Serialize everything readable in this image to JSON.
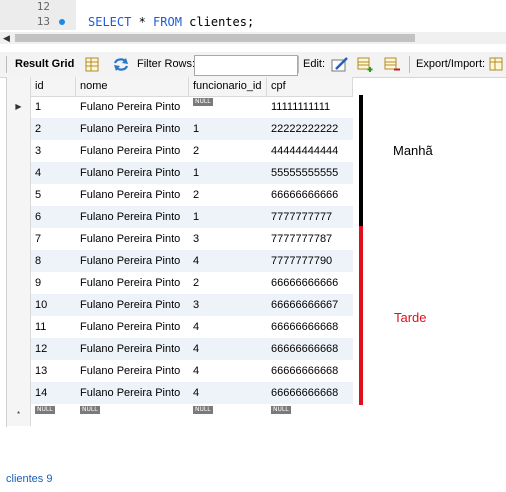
{
  "editor": {
    "lines": [
      {
        "number": "12",
        "code_kw1": "",
        "code_text": "",
        "code_kw2": "",
        "code_tail": ""
      },
      {
        "number": "13",
        "code_kw1": "SELECT",
        "code_text": " * ",
        "code_kw2": "FROM",
        "code_tail": " clientes;"
      }
    ]
  },
  "toolbar": {
    "result_grid": "Result Grid",
    "filter_rows": "Filter Rows:",
    "filter_value": "",
    "edit": "Edit:",
    "export_import": "Export/Import:"
  },
  "grid": {
    "columns": [
      "id",
      "nome",
      "funcionario_id",
      "cpf"
    ],
    "null_label": "NULL",
    "rows": [
      {
        "id": "1",
        "nome": "Fulano Pereira Pinto",
        "funcionario_id": "NULL",
        "cpf": "11111111111"
      },
      {
        "id": "2",
        "nome": "Fulano Pereira Pinto",
        "funcionario_id": "1",
        "cpf": "22222222222"
      },
      {
        "id": "3",
        "nome": "Fulano Pereira Pinto",
        "funcionario_id": "2",
        "cpf": "44444444444"
      },
      {
        "id": "4",
        "nome": "Fulano Pereira Pinto",
        "funcionario_id": "1",
        "cpf": "55555555555"
      },
      {
        "id": "5",
        "nome": "Fulano Pereira Pinto",
        "funcionario_id": "2",
        "cpf": "66666666666"
      },
      {
        "id": "6",
        "nome": "Fulano Pereira Pinto",
        "funcionario_id": "1",
        "cpf": "7777777777"
      },
      {
        "id": "7",
        "nome": "Fulano Pereira Pinto",
        "funcionario_id": "3",
        "cpf": "7777777787"
      },
      {
        "id": "8",
        "nome": "Fulano Pereira Pinto",
        "funcionario_id": "4",
        "cpf": "7777777790"
      },
      {
        "id": "9",
        "nome": "Fulano Pereira Pinto",
        "funcionario_id": "2",
        "cpf": "66666666666"
      },
      {
        "id": "10",
        "nome": "Fulano Pereira Pinto",
        "funcionario_id": "3",
        "cpf": "66666666667"
      },
      {
        "id": "11",
        "nome": "Fulano Pereira Pinto",
        "funcionario_id": "4",
        "cpf": "66666666668"
      },
      {
        "id": "12",
        "nome": "Fulano Pereira Pinto",
        "funcionario_id": "4",
        "cpf": "66666666668"
      },
      {
        "id": "13",
        "nome": "Fulano Pereira Pinto",
        "funcionario_id": "4",
        "cpf": "66666666668"
      },
      {
        "id": "14",
        "nome": "Fulano Pereira Pinto",
        "funcionario_id": "4",
        "cpf": "66666666668"
      },
      {
        "id": "NULL",
        "nome": "NULL",
        "funcionario_id": "NULL",
        "cpf": "NULL",
        "new": true
      }
    ],
    "colors": {
      "alt_row": "#eef3fa",
      "null_badge": "#7a7a7a"
    }
  },
  "annotations": {
    "manha": "Manhã",
    "tarde": "Tarde",
    "colors": {
      "manha_bar": "#000000",
      "tarde_bar": "#e0101b"
    }
  },
  "bottom_tab": {
    "label": "clientes 9"
  }
}
